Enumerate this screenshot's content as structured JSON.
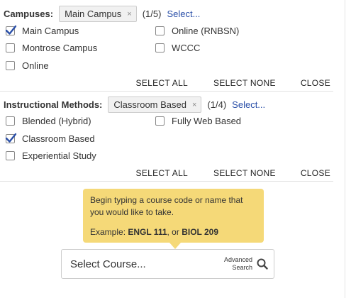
{
  "campuses": {
    "label": "Campuses:",
    "chip": "Main Campus",
    "chip_remove": "×",
    "count": "(1/5)",
    "select_link": "Select...",
    "options": [
      {
        "label": "Main Campus",
        "checked": true
      },
      {
        "label": "Online (RNBSN)",
        "checked": false
      },
      {
        "label": "Montrose Campus",
        "checked": false
      },
      {
        "label": "WCCC",
        "checked": false
      },
      {
        "label": "Online",
        "checked": false
      }
    ],
    "actions": {
      "select_all": "SELECT ALL",
      "select_none": "SELECT NONE",
      "close": "CLOSE"
    }
  },
  "methods": {
    "label": "Instructional Methods:",
    "chip": "Classroom Based",
    "chip_remove": "×",
    "count": "(1/4)",
    "select_link": "Select...",
    "options": [
      {
        "label": "Blended (Hybrid)",
        "checked": false
      },
      {
        "label": "Fully Web Based",
        "checked": false
      },
      {
        "label": "Classroom Based",
        "checked": true
      },
      {
        "label": "Experiential Study",
        "checked": false
      }
    ],
    "actions": {
      "select_all": "SELECT ALL",
      "select_none": "SELECT NONE",
      "close": "CLOSE"
    }
  },
  "tooltip": {
    "line1": "Begin typing a course code or name that",
    "line2": "you would like to take.",
    "example_prefix": "Example: ",
    "example_code1": "ENGL 111",
    "example_mid": ", or ",
    "example_code2": "BIOL 209"
  },
  "course_search": {
    "placeholder": "Select Course...",
    "advanced_line1": "Advanced",
    "advanced_line2": "Search"
  },
  "colors": {
    "accent": "#2a4fa8",
    "tooltip_bg": "#f5d978"
  }
}
